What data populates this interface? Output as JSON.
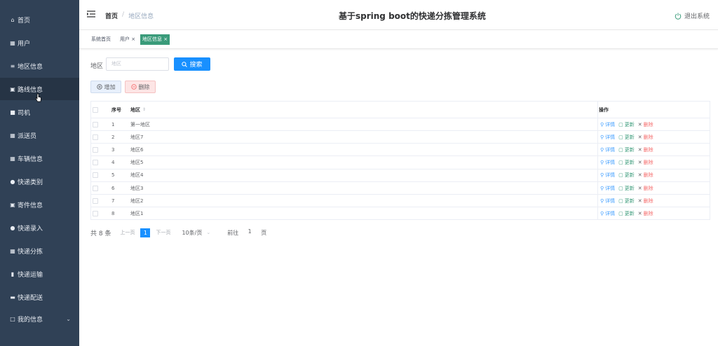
{
  "sidebar": {
    "items": [
      {
        "label": "首页",
        "icon": "home-icon"
      },
      {
        "label": "用户",
        "icon": "grid-icon"
      },
      {
        "label": "地区信息",
        "icon": "list-icon"
      },
      {
        "label": "路线信息",
        "icon": "doc-icon"
      },
      {
        "label": "司机",
        "icon": "car-icon"
      },
      {
        "label": "派送员",
        "icon": "grid-icon"
      },
      {
        "label": "车辆信息",
        "icon": "grid-icon"
      },
      {
        "label": "快递类别",
        "icon": "user-icon"
      },
      {
        "label": "寄件信息",
        "icon": "doc-icon"
      },
      {
        "label": "快递录入",
        "icon": "user-icon"
      },
      {
        "label": "快递分拣",
        "icon": "grid-icon"
      },
      {
        "label": "快递运输",
        "icon": "bar-chart-icon"
      },
      {
        "label": "快递配送",
        "icon": "ticket-icon"
      },
      {
        "label": "我的信息",
        "icon": "window-icon"
      }
    ]
  },
  "header": {
    "breadcrumb_home": "首页",
    "breadcrumb_sep": "/",
    "breadcrumb_current": "地区信息",
    "title": "基于spring boot的快递分拣管理系统",
    "logout_label": "退出系统"
  },
  "tags": [
    {
      "label": "系统首页",
      "closable": false
    },
    {
      "label": "用户",
      "closable": true
    },
    {
      "label": "地区信息",
      "closable": true,
      "active": true
    }
  ],
  "search": {
    "label": "地区",
    "placeholder": "地区",
    "value": "",
    "button_label": "搜索"
  },
  "actions": {
    "add_label": "增加",
    "delete_label": "删除"
  },
  "table": {
    "columns": {
      "index": "序号",
      "region": "地区",
      "ops": "操作"
    },
    "rows": [
      {
        "index": "1",
        "region": "第一地区"
      },
      {
        "index": "2",
        "region": "地区7"
      },
      {
        "index": "3",
        "region": "地区6"
      },
      {
        "index": "4",
        "region": "地区5"
      },
      {
        "index": "5",
        "region": "地区4"
      },
      {
        "index": "6",
        "region": "地区3"
      },
      {
        "index": "7",
        "region": "地区2"
      },
      {
        "index": "8",
        "region": "地区1"
      }
    ],
    "op_labels": {
      "view": "详情",
      "edit": "更新",
      "delete": "删除"
    }
  },
  "pagination": {
    "total": "共 8 条",
    "prev": "上一页",
    "current": "1",
    "next": "下一页",
    "page_size": "10条/页",
    "goto_label": "前往",
    "goto_value": "1",
    "page_unit": "页"
  },
  "colors": {
    "sidebar_bg": "#304156",
    "primary": "#1890ff",
    "active_tag": "#3a9b7a",
    "danger": "#f56c6c"
  }
}
